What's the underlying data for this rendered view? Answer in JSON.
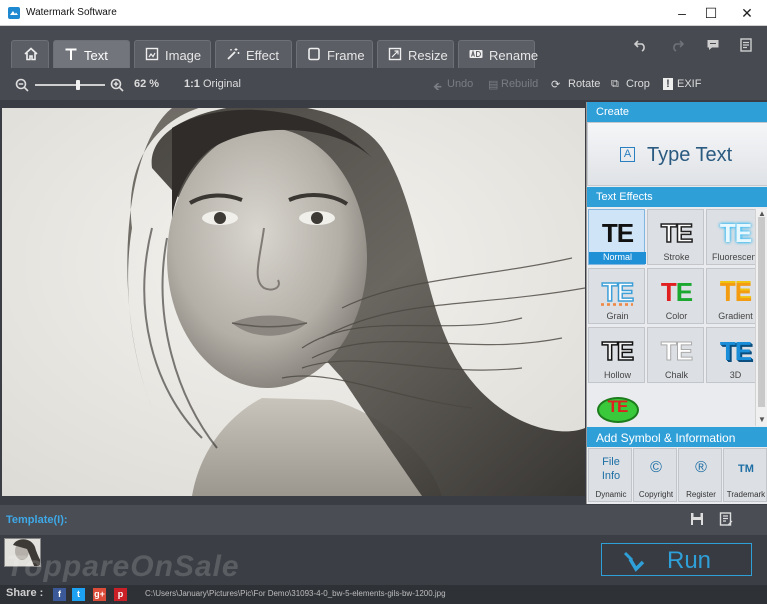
{
  "window": {
    "title": "Watermark Software",
    "minimize": "–",
    "maximize": "☐",
    "close": "✕"
  },
  "tabs": [
    {
      "label": "",
      "icon": "home-icon"
    },
    {
      "label": "Text",
      "icon": "text-icon"
    },
    {
      "label": "Image",
      "icon": "image-icon"
    },
    {
      "label": "Effect",
      "icon": "wand-icon"
    },
    {
      "label": "Frame",
      "icon": "frame-icon"
    },
    {
      "label": "Resize",
      "icon": "resize-icon"
    },
    {
      "label": "Rename",
      "icon": "rename-icon"
    }
  ],
  "toolbar": {
    "zoom_percent": "62 %",
    "zoom_fraction": 0.62,
    "original": "Original",
    "undo": "Undo",
    "rebuild": "Rebuild",
    "rotate": "Rotate",
    "crop": "Crop",
    "exif": "EXIF"
  },
  "panel": {
    "create_header": "Create",
    "type_text": "Type Text",
    "effects_header": "Text Effects",
    "effect_glyph": "TE",
    "effects": [
      {
        "label": "Normal",
        "selected": true
      },
      {
        "label": "Stroke",
        "selected": false
      },
      {
        "label": "Fluorescent",
        "selected": false
      },
      {
        "label": "Grain",
        "selected": false
      },
      {
        "label": "Color",
        "selected": false
      },
      {
        "label": "Gradient",
        "selected": false
      },
      {
        "label": "Hollow",
        "selected": false
      },
      {
        "label": "Chalk",
        "selected": false
      },
      {
        "label": "3D",
        "selected": false
      },
      {
        "label": "",
        "selected": false
      }
    ],
    "symbol_header": "Add Symbol & Information",
    "symbols": [
      {
        "glyph": "File Info",
        "label": "Dynamic"
      },
      {
        "glyph": "©",
        "label": "Copyright"
      },
      {
        "glyph": "®",
        "label": "Register"
      },
      {
        "glyph": "TM",
        "label": "Trademark"
      }
    ]
  },
  "template": {
    "label": "Template(I):"
  },
  "run": {
    "label": "Run"
  },
  "watermark_text": "ToppareOnSale",
  "status": {
    "share_label": "Share :",
    "file_path": "C:\\Users\\January\\Pictures\\Pic\\For Demo\\31093-4-0_bw-5-elements-gils-bw-1200.jpg"
  },
  "colors": {
    "accent": "#2f9fd8",
    "selected": "#1f8fd6",
    "run": "#2f9fd8"
  }
}
